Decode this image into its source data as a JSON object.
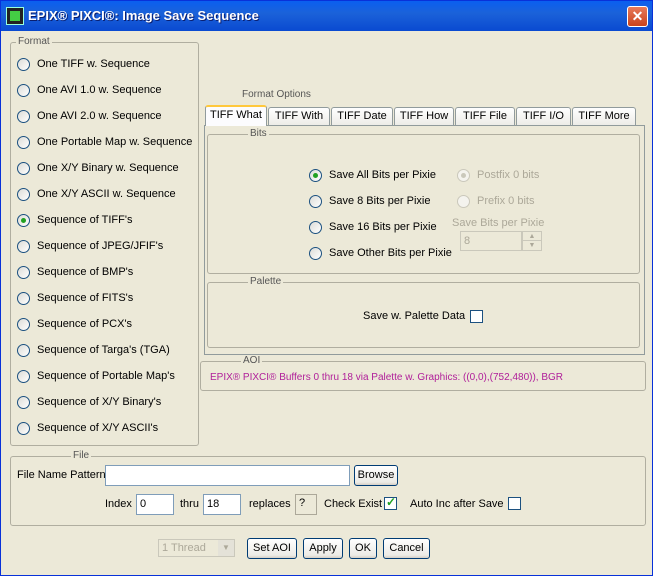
{
  "window": {
    "title": "EPIX® PIXCI®: Image Save Sequence",
    "close_label": "✕",
    "icon": "app-icon"
  },
  "format": {
    "legend": "Format",
    "options": [
      "One TIFF w. Sequence",
      "One AVI 1.0 w. Sequence",
      "One AVI 2.0 w. Sequence",
      "One Portable Map w. Sequence",
      "One X/Y Binary w. Sequence",
      "One X/Y ASCII w. Sequence",
      "Sequence of TIFF's",
      "Sequence of JPEG/JFIF's",
      "Sequence of BMP's",
      "Sequence of FITS's",
      "Sequence of PCX's",
      "Sequence of Targa's (TGA)",
      "Sequence of Portable Map's",
      "Sequence of X/Y Binary's",
      "Sequence of X/Y ASCII's"
    ],
    "selected": "Sequence of TIFF's"
  },
  "format_options": {
    "legend": "Format Options",
    "tabs": [
      "TIFF What",
      "TIFF With",
      "TIFF Date",
      "TIFF How",
      "TIFF File",
      "TIFF I/O",
      "TIFF More"
    ],
    "active_tab": "TIFF What",
    "bits": {
      "legend": "Bits",
      "options": [
        "Save All Bits per Pixie",
        "Save 8 Bits per Pixie",
        "Save 16 Bits per Pixie",
        "Save Other Bits per Pixie"
      ],
      "selected": "Save All Bits per Pixie",
      "postfix_label": "Postfix 0 bits",
      "prefix_label": "Prefix 0 bits",
      "save_bits_label": "Save Bits per Pixie",
      "save_bits_value": "8"
    },
    "palette": {
      "legend": "Palette",
      "label": "Save w. Palette Data",
      "checked": false
    }
  },
  "aoi": {
    "legend": "AOI",
    "text": "EPIX® PIXCI® Buffers 0 thru 18 via Palette w. Graphics: ((0,0),(752,480)), BGR"
  },
  "file": {
    "legend": "File",
    "pattern_label": "File Name Pattern",
    "pattern_value": "",
    "browse_label": "Browse",
    "index_label": "Index",
    "index_value": "0",
    "thru_label": "thru",
    "thru_value": "18",
    "replaces_label": "replaces",
    "replaces_value": "?",
    "check_exist_label": "Check Exist",
    "check_exist_checked": true,
    "auto_inc_label": "Auto Inc after Save",
    "auto_inc_checked": false
  },
  "footer": {
    "thread_value": "1 Thread",
    "set_aoi_label": "Set AOI",
    "apply_label": "Apply",
    "ok_label": "OK",
    "cancel_label": "Cancel"
  }
}
